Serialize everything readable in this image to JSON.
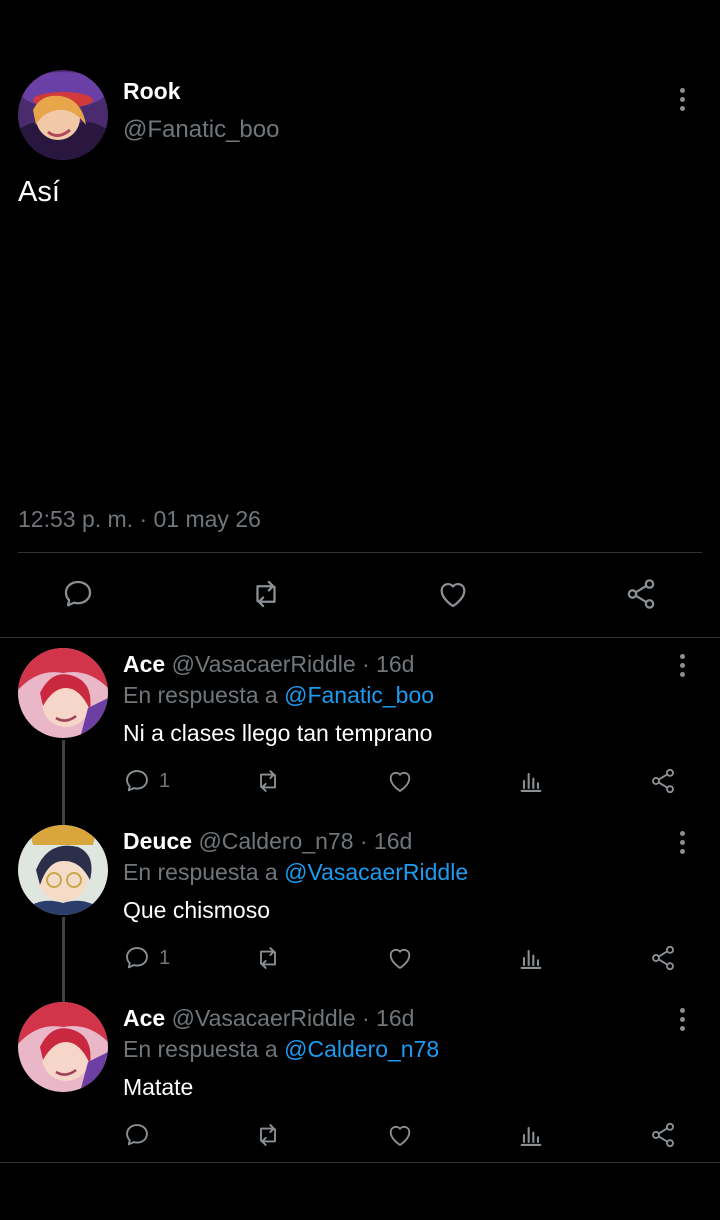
{
  "main_tweet": {
    "name": "Rook",
    "handle": "@Fanatic_boo",
    "text": "Así",
    "timestamp": "12:53 p. m. · 01 may 26",
    "actions": [
      "reply-icon",
      "retweet-icon",
      "like-icon",
      "share-icon"
    ]
  },
  "replies": [
    {
      "name": "Ace",
      "meta": "@VasacaerRiddle · 16d",
      "reply_prefix": "En respuesta a ",
      "reply_to": "@Fanatic_boo",
      "text": "Ni a clases llego tan temprano",
      "reply_count": "1"
    },
    {
      "name": "Deuce",
      "meta": "@Caldero_n78 · 16d",
      "reply_prefix": "En respuesta a ",
      "reply_to": "@VasacaerRiddle",
      "text": "Que chismoso",
      "reply_count": "1"
    },
    {
      "name": "Ace",
      "meta": "@VasacaerRiddle · 16d",
      "reply_prefix": "En respuesta a ",
      "reply_to": "@Caldero_n78",
      "text": "Matate",
      "reply_count": ""
    }
  ],
  "colors": {
    "background": "#000000",
    "text": "#e7e9ea",
    "muted": "#71767b",
    "link": "#1d9bf0",
    "border": "#2f3336"
  }
}
